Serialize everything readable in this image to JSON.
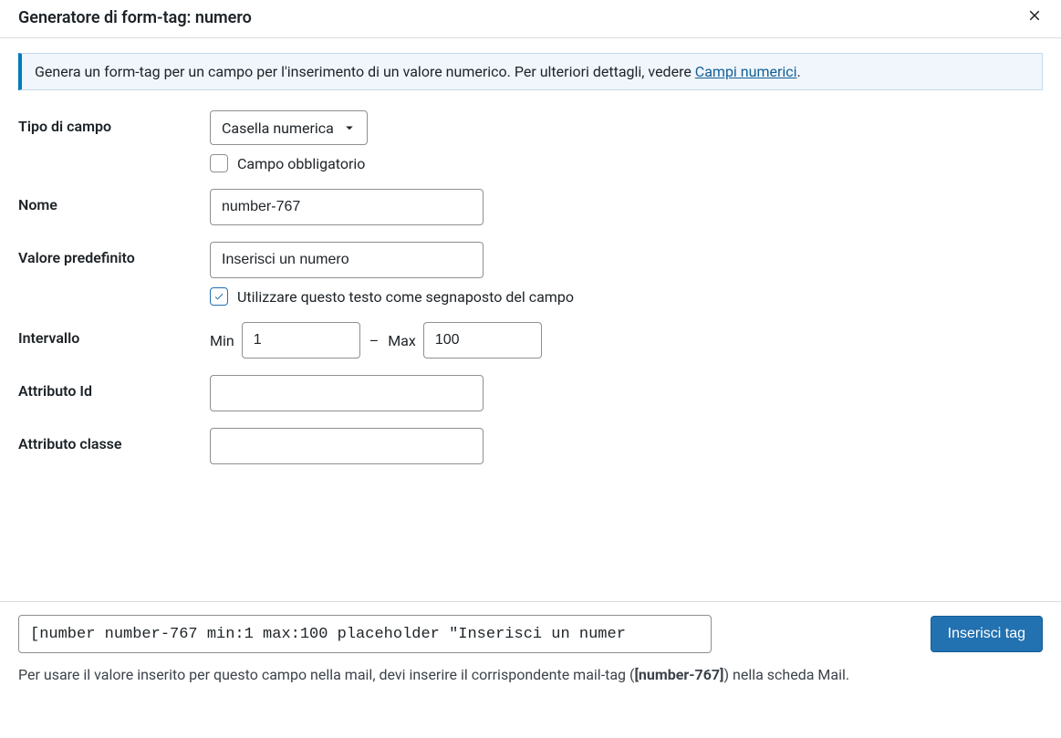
{
  "header": {
    "title": "Generatore di form-tag: numero"
  },
  "notice": {
    "text_before": "Genera un form-tag per un campo per l'inserimento di un valore numerico. Per ulteriori dettagli, vedere ",
    "link_text": "Campi numerici",
    "text_after": "."
  },
  "fields": {
    "type": {
      "label": "Tipo di campo",
      "selected": "Casella numerica",
      "required_label": "Campo obbligatorio"
    },
    "name": {
      "label": "Nome",
      "value": "number-767"
    },
    "default": {
      "label": "Valore predefinito",
      "value": "Inserisci un numero",
      "placeholder_label": "Utilizzare questo testo come segnaposto del campo"
    },
    "range": {
      "label": "Intervallo",
      "min_label": "Min",
      "min_value": "1",
      "max_label": "Max",
      "max_value": "100",
      "separator": "–"
    },
    "id": {
      "label": "Attributo Id",
      "value": ""
    },
    "class": {
      "label": "Attributo classe",
      "value": ""
    }
  },
  "footer": {
    "tag_value": "[number number-767 min:1 max:100 placeholder \"Inserisci un numer",
    "insert_label": "Inserisci tag",
    "hint_before": "Per usare il valore inserito per questo campo nella mail, devi inserire il corrispondente mail-tag (",
    "hint_bold": "[number-767]",
    "hint_after": ") nella scheda Mail."
  }
}
